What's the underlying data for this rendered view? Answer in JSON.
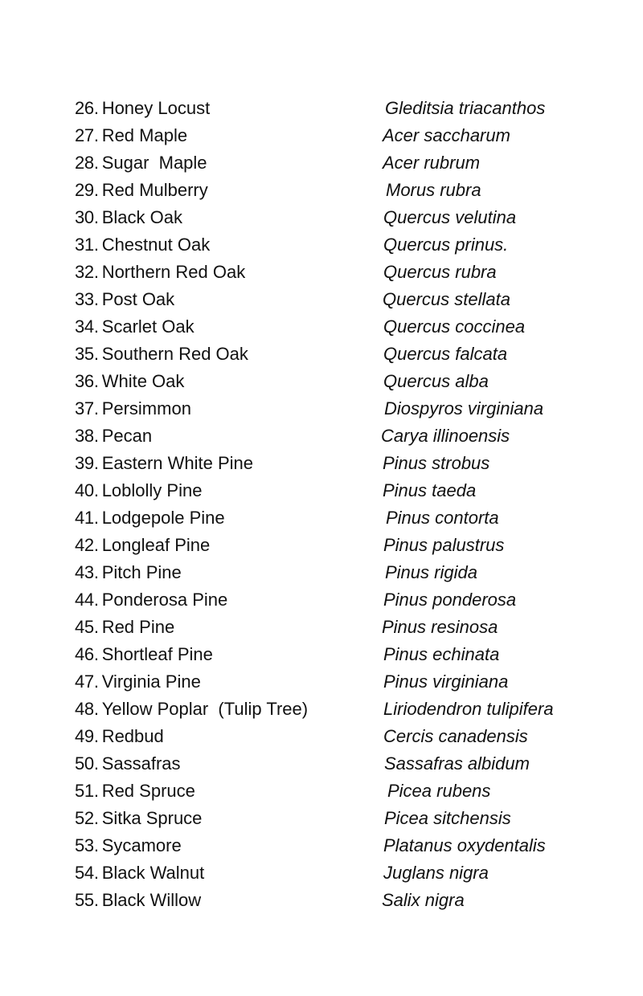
{
  "document": {
    "entries": [
      {
        "number": "26.",
        "common": "Honey Locust",
        "scientific": "Gleditsia triacanthos"
      },
      {
        "number": "27.",
        "common": "Red Maple",
        "scientific": "Acer saccharum"
      },
      {
        "number": "28.",
        "common": "Sugar  Maple",
        "scientific": "Acer rubrum"
      },
      {
        "number": "29.",
        "common": "Red Mulberry",
        "scientific": "Morus rubra"
      },
      {
        "number": "30.",
        "common": "Black Oak",
        "scientific": "Quercus velutina"
      },
      {
        "number": "31.",
        "common": "Chestnut Oak",
        "scientific": "Quercus prinus."
      },
      {
        "number": "32.",
        "common": "Northern Red Oak",
        "scientific": "Quercus rubra"
      },
      {
        "number": "33.",
        "common": "Post Oak",
        "scientific": "Quercus stellata"
      },
      {
        "number": "34.",
        "common": "Scarlet Oak",
        "scientific": "Quercus coccinea"
      },
      {
        "number": "35.",
        "common": "Southern Red Oak",
        "scientific": "Quercus falcata"
      },
      {
        "number": "36.",
        "common": "White Oak",
        "scientific": "Quercus alba"
      },
      {
        "number": "37.",
        "common": "Persimmon",
        "scientific": "Diospyros virginiana"
      },
      {
        "number": "38.",
        "common": "Pecan",
        "scientific": "Carya illinoensis"
      },
      {
        "number": "39.",
        "common": "Eastern White Pine",
        "scientific": "Pinus strobus"
      },
      {
        "number": "40.",
        "common": "Loblolly Pine",
        "scientific": "Pinus taeda"
      },
      {
        "number": "41.",
        "common": "Lodgepole Pine",
        "scientific": "Pinus contorta"
      },
      {
        "number": "42.",
        "common": "Longleaf Pine",
        "scientific": "Pinus palustrus"
      },
      {
        "number": "43.",
        "common": "Pitch Pine",
        "scientific": "Pinus rigida"
      },
      {
        "number": "44.",
        "common": "Ponderosa Pine",
        "scientific": "Pinus ponderosa"
      },
      {
        "number": "45.",
        "common": "Red Pine",
        "scientific": "Pinus resinosa"
      },
      {
        "number": "46.",
        "common": "Shortleaf Pine",
        "scientific": "Pinus echinata"
      },
      {
        "number": "47.",
        "common": "Virginia Pine",
        "scientific": "Pinus virginiana"
      },
      {
        "number": "48.",
        "common": "Yellow Poplar  (Tulip Tree)",
        "scientific": "Liriodendron tulipifera"
      },
      {
        "number": "49.",
        "common": "Redbud",
        "scientific": "Cercis canadensis"
      },
      {
        "number": "50.",
        "common": "Sassafras",
        "scientific": "Sassafras albidum"
      },
      {
        "number": "51.",
        "common": "Red Spruce",
        "scientific": "Picea rubens"
      },
      {
        "number": "52.",
        "common": "Sitka Spruce",
        "scientific": "Picea sitchensis"
      },
      {
        "number": "53.",
        "common": "Sycamore",
        "scientific": "Platanus oxydentalis"
      },
      {
        "number": "54.",
        "common": "Black Walnut",
        "scientific": "Juglans nigra"
      },
      {
        "number": "55.",
        "common": "Black Willow",
        "scientific": "Salix nigra"
      }
    ]
  }
}
